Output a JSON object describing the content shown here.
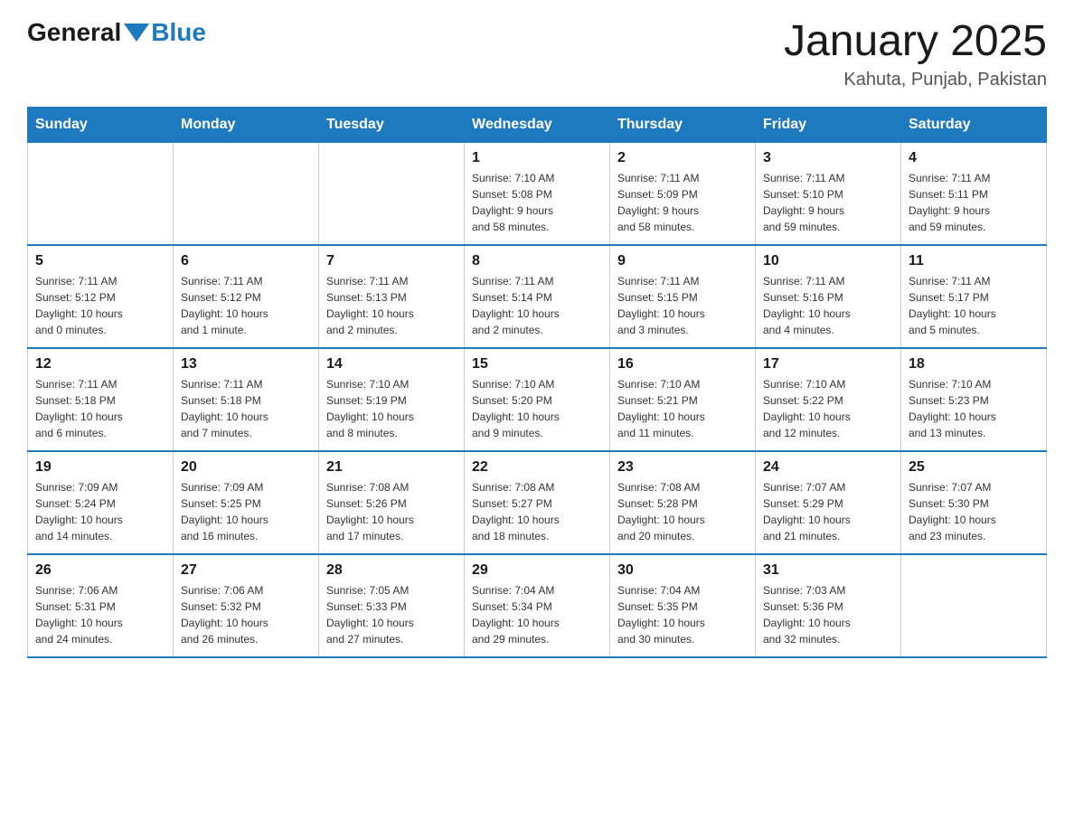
{
  "header": {
    "logo_general": "General",
    "logo_blue": "Blue",
    "title": "January 2025",
    "subtitle": "Kahuta, Punjab, Pakistan"
  },
  "weekdays": [
    "Sunday",
    "Monday",
    "Tuesday",
    "Wednesday",
    "Thursday",
    "Friday",
    "Saturday"
  ],
  "weeks": [
    [
      {
        "day": "",
        "info": ""
      },
      {
        "day": "",
        "info": ""
      },
      {
        "day": "",
        "info": ""
      },
      {
        "day": "1",
        "info": "Sunrise: 7:10 AM\nSunset: 5:08 PM\nDaylight: 9 hours\nand 58 minutes."
      },
      {
        "day": "2",
        "info": "Sunrise: 7:11 AM\nSunset: 5:09 PM\nDaylight: 9 hours\nand 58 minutes."
      },
      {
        "day": "3",
        "info": "Sunrise: 7:11 AM\nSunset: 5:10 PM\nDaylight: 9 hours\nand 59 minutes."
      },
      {
        "day": "4",
        "info": "Sunrise: 7:11 AM\nSunset: 5:11 PM\nDaylight: 9 hours\nand 59 minutes."
      }
    ],
    [
      {
        "day": "5",
        "info": "Sunrise: 7:11 AM\nSunset: 5:12 PM\nDaylight: 10 hours\nand 0 minutes."
      },
      {
        "day": "6",
        "info": "Sunrise: 7:11 AM\nSunset: 5:12 PM\nDaylight: 10 hours\nand 1 minute."
      },
      {
        "day": "7",
        "info": "Sunrise: 7:11 AM\nSunset: 5:13 PM\nDaylight: 10 hours\nand 2 minutes."
      },
      {
        "day": "8",
        "info": "Sunrise: 7:11 AM\nSunset: 5:14 PM\nDaylight: 10 hours\nand 2 minutes."
      },
      {
        "day": "9",
        "info": "Sunrise: 7:11 AM\nSunset: 5:15 PM\nDaylight: 10 hours\nand 3 minutes."
      },
      {
        "day": "10",
        "info": "Sunrise: 7:11 AM\nSunset: 5:16 PM\nDaylight: 10 hours\nand 4 minutes."
      },
      {
        "day": "11",
        "info": "Sunrise: 7:11 AM\nSunset: 5:17 PM\nDaylight: 10 hours\nand 5 minutes."
      }
    ],
    [
      {
        "day": "12",
        "info": "Sunrise: 7:11 AM\nSunset: 5:18 PM\nDaylight: 10 hours\nand 6 minutes."
      },
      {
        "day": "13",
        "info": "Sunrise: 7:11 AM\nSunset: 5:18 PM\nDaylight: 10 hours\nand 7 minutes."
      },
      {
        "day": "14",
        "info": "Sunrise: 7:10 AM\nSunset: 5:19 PM\nDaylight: 10 hours\nand 8 minutes."
      },
      {
        "day": "15",
        "info": "Sunrise: 7:10 AM\nSunset: 5:20 PM\nDaylight: 10 hours\nand 9 minutes."
      },
      {
        "day": "16",
        "info": "Sunrise: 7:10 AM\nSunset: 5:21 PM\nDaylight: 10 hours\nand 11 minutes."
      },
      {
        "day": "17",
        "info": "Sunrise: 7:10 AM\nSunset: 5:22 PM\nDaylight: 10 hours\nand 12 minutes."
      },
      {
        "day": "18",
        "info": "Sunrise: 7:10 AM\nSunset: 5:23 PM\nDaylight: 10 hours\nand 13 minutes."
      }
    ],
    [
      {
        "day": "19",
        "info": "Sunrise: 7:09 AM\nSunset: 5:24 PM\nDaylight: 10 hours\nand 14 minutes."
      },
      {
        "day": "20",
        "info": "Sunrise: 7:09 AM\nSunset: 5:25 PM\nDaylight: 10 hours\nand 16 minutes."
      },
      {
        "day": "21",
        "info": "Sunrise: 7:08 AM\nSunset: 5:26 PM\nDaylight: 10 hours\nand 17 minutes."
      },
      {
        "day": "22",
        "info": "Sunrise: 7:08 AM\nSunset: 5:27 PM\nDaylight: 10 hours\nand 18 minutes."
      },
      {
        "day": "23",
        "info": "Sunrise: 7:08 AM\nSunset: 5:28 PM\nDaylight: 10 hours\nand 20 minutes."
      },
      {
        "day": "24",
        "info": "Sunrise: 7:07 AM\nSunset: 5:29 PM\nDaylight: 10 hours\nand 21 minutes."
      },
      {
        "day": "25",
        "info": "Sunrise: 7:07 AM\nSunset: 5:30 PM\nDaylight: 10 hours\nand 23 minutes."
      }
    ],
    [
      {
        "day": "26",
        "info": "Sunrise: 7:06 AM\nSunset: 5:31 PM\nDaylight: 10 hours\nand 24 minutes."
      },
      {
        "day": "27",
        "info": "Sunrise: 7:06 AM\nSunset: 5:32 PM\nDaylight: 10 hours\nand 26 minutes."
      },
      {
        "day": "28",
        "info": "Sunrise: 7:05 AM\nSunset: 5:33 PM\nDaylight: 10 hours\nand 27 minutes."
      },
      {
        "day": "29",
        "info": "Sunrise: 7:04 AM\nSunset: 5:34 PM\nDaylight: 10 hours\nand 29 minutes."
      },
      {
        "day": "30",
        "info": "Sunrise: 7:04 AM\nSunset: 5:35 PM\nDaylight: 10 hours\nand 30 minutes."
      },
      {
        "day": "31",
        "info": "Sunrise: 7:03 AM\nSunset: 5:36 PM\nDaylight: 10 hours\nand 32 minutes."
      },
      {
        "day": "",
        "info": ""
      }
    ]
  ]
}
